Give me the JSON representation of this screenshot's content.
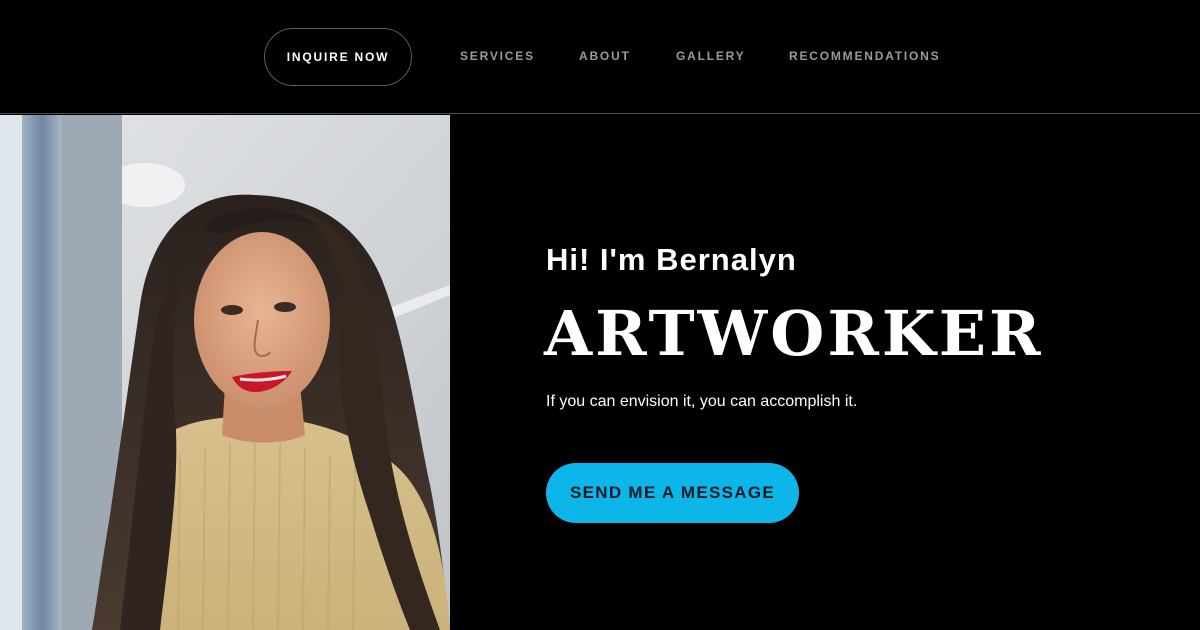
{
  "header": {
    "inquire_label": "INQUIRE NOW",
    "nav": {
      "services": "SERVICES",
      "about": "ABOUT",
      "gallery": "GALLERY",
      "recommendations": "RECOMMENDATIONS"
    }
  },
  "hero": {
    "greeting": "Hi! I'm Bernalyn",
    "role": "ARTWORKER",
    "tagline": "If you can envision it, you can accomplish it.",
    "cta_label": "SEND ME A MESSAGE"
  },
  "colors": {
    "background": "#000000",
    "accent": "#0db6e8",
    "nav_text": "#9a9a9a",
    "text": "#ffffff"
  }
}
